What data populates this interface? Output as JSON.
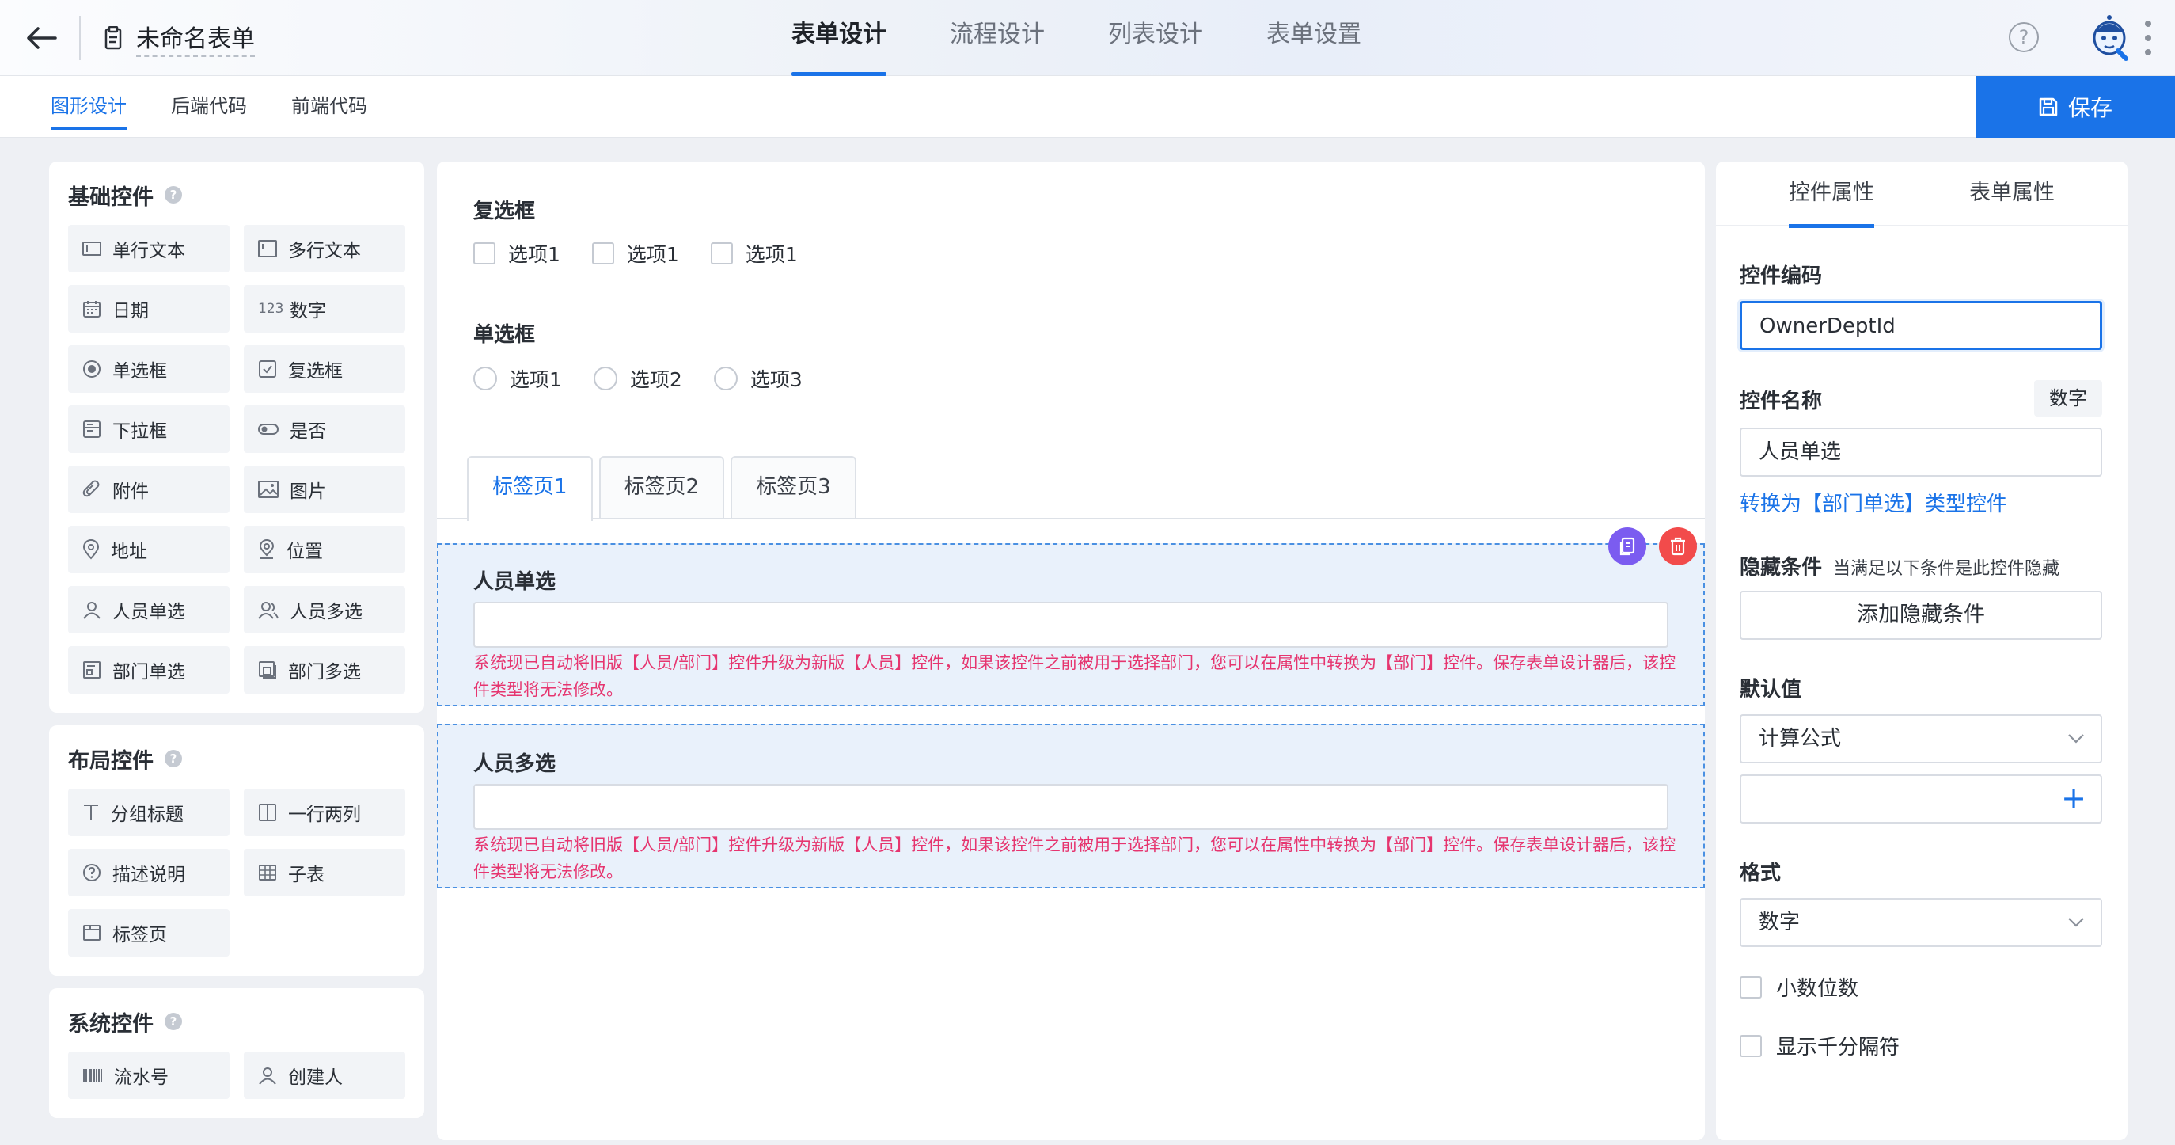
{
  "header": {
    "title": "未命名表单",
    "tabs": [
      {
        "label": "表单设计",
        "active": true
      },
      {
        "label": "流程设计",
        "active": false
      },
      {
        "label": "列表设计",
        "active": false
      },
      {
        "label": "表单设置",
        "active": false
      }
    ],
    "help": "?"
  },
  "subnav": {
    "tabs": [
      {
        "label": "图形设计",
        "active": true
      },
      {
        "label": "后端代码",
        "active": false
      },
      {
        "label": "前端代码",
        "active": false
      }
    ],
    "save_label": "保存"
  },
  "left": {
    "basic": {
      "title": "基础控件",
      "items": [
        {
          "label": "单行文本",
          "icon": "single-line-text-icon"
        },
        {
          "label": "多行文本",
          "icon": "multi-line-text-icon"
        },
        {
          "label": "日期",
          "icon": "calendar-icon"
        },
        {
          "label": "数字",
          "icon": "number-icon"
        },
        {
          "label": "单选框",
          "icon": "radio-icon"
        },
        {
          "label": "复选框",
          "icon": "checkbox-icon"
        },
        {
          "label": "下拉框",
          "icon": "dropdown-icon"
        },
        {
          "label": "是否",
          "icon": "toggle-icon"
        },
        {
          "label": "附件",
          "icon": "paperclip-icon"
        },
        {
          "label": "图片",
          "icon": "image-icon"
        },
        {
          "label": "地址",
          "icon": "location-pin-icon"
        },
        {
          "label": "位置",
          "icon": "position-icon"
        },
        {
          "label": "人员单选",
          "icon": "user-icon"
        },
        {
          "label": "人员多选",
          "icon": "users-icon"
        },
        {
          "label": "部门单选",
          "icon": "department-icon"
        },
        {
          "label": "部门多选",
          "icon": "departments-icon"
        }
      ]
    },
    "layout": {
      "title": "布局控件",
      "items": [
        {
          "label": "分组标题",
          "icon": "group-title-icon"
        },
        {
          "label": "一行两列",
          "icon": "two-column-icon"
        },
        {
          "label": "描述说明",
          "icon": "description-icon"
        },
        {
          "label": "子表",
          "icon": "subtable-icon"
        },
        {
          "label": "标签页",
          "icon": "tab-page-icon"
        }
      ]
    },
    "system": {
      "title": "系统控件",
      "items": [
        {
          "label": "流水号",
          "icon": "barcode-icon"
        },
        {
          "label": "创建人",
          "icon": "creator-icon"
        }
      ]
    }
  },
  "canvas": {
    "checkbox_field": {
      "label": "复选框",
      "options": [
        "选项1",
        "选项1",
        "选项1"
      ]
    },
    "radio_field": {
      "label": "单选框",
      "options": [
        "选项1",
        "选项2",
        "选项3"
      ]
    },
    "tabs": [
      {
        "label": "标签页1",
        "active": true
      },
      {
        "label": "标签页2",
        "active": false
      },
      {
        "label": "标签页3",
        "active": false
      }
    ],
    "user_single": {
      "label": "人员单选",
      "warning": "系统现已自动将旧版【人员/部门】控件升级为新版【人员】控件，如果该控件之前被用于选择部门，您可以在属性中转换为【部门】控件。保存表单设计器后，该控件类型将无法修改。"
    },
    "user_multi": {
      "label": "人员多选",
      "warning": "系统现已自动将旧版【人员/部门】控件升级为新版【人员】控件，如果该控件之前被用于选择部门，您可以在属性中转换为【部门】控件。保存表单设计器后，该控件类型将无法修改。"
    }
  },
  "right": {
    "tabs": [
      {
        "label": "控件属性",
        "active": true
      },
      {
        "label": "表单属性",
        "active": false
      }
    ],
    "code_label": "控件编码",
    "code_value": "OwnerDeptId",
    "name_label": "控件名称",
    "name_tag": "数字",
    "name_value": "人员单选",
    "convert_link": "转换为【部门单选】类型控件",
    "hide_label": "隐藏条件",
    "hide_hint": "当满足以下条件是此控件隐藏",
    "hide_button": "添加隐藏条件",
    "default_label": "默认值",
    "default_select": "计算公式",
    "default_plus": "+",
    "format_label": "格式",
    "format_select": "数字",
    "decimal_label": "小数位数",
    "thousands_label": "显示千分隔符"
  },
  "colors": {
    "accent": "#1a73e8",
    "warning": "#e6356f",
    "copy_button": "#7b5cf0",
    "delete_button": "#f24b4b"
  }
}
